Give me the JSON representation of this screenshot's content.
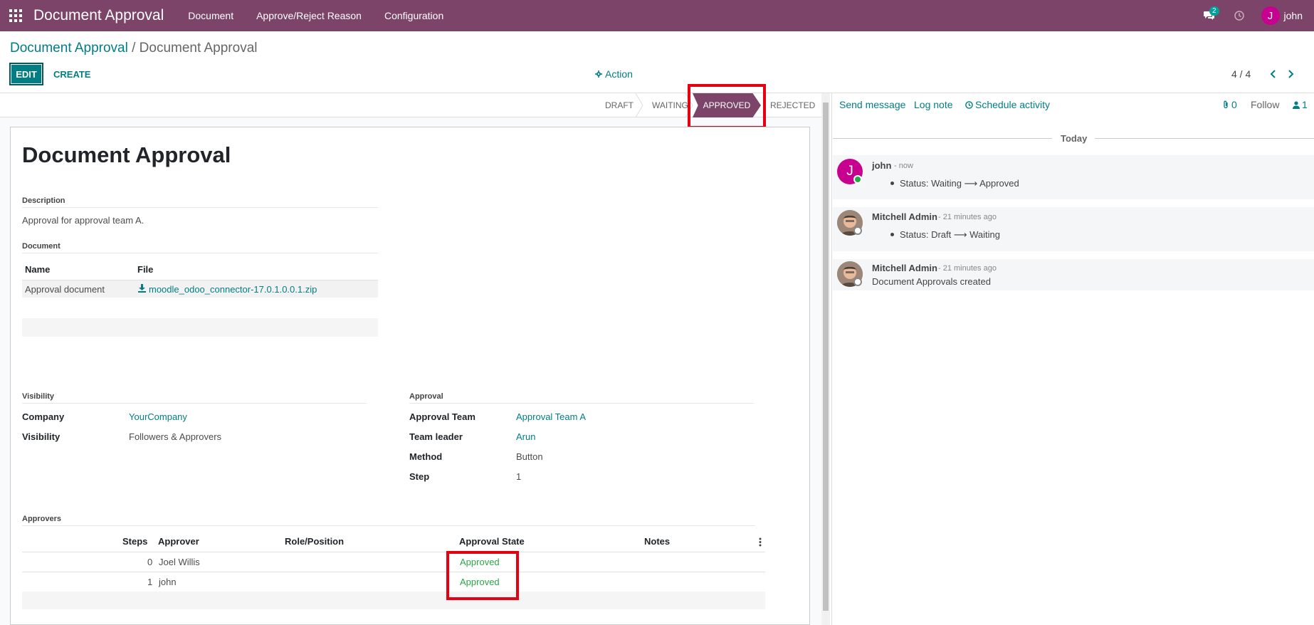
{
  "navbar": {
    "app_title": "Document Approval",
    "menu": [
      "Document",
      "Approve/Reject Reason",
      "Configuration"
    ],
    "messages_count": "2",
    "user_initial": "J",
    "user_name": "john"
  },
  "breadcrumb": {
    "parent": "Document Approval",
    "separator": "/",
    "current": "Document Approval"
  },
  "toolbar": {
    "edit_label": "EDIT",
    "create_label": "CREATE",
    "action_label": "Action",
    "pager": "4 / 4"
  },
  "statusbar": {
    "stages": [
      "DRAFT",
      "WAITING",
      "APPROVED",
      "REJECTED"
    ],
    "active": "APPROVED"
  },
  "form": {
    "title": "Document Approval",
    "description_label": "Description",
    "description": "Approval for approval team A.",
    "document_label": "Document",
    "doc_table": {
      "headers": [
        "Name",
        "File"
      ],
      "rows": [
        {
          "name": "Approval document",
          "file": "moodle_odoo_connector-17.0.1.0.0.1.zip"
        }
      ]
    },
    "visibility_section": "Visibility",
    "company_label": "Company",
    "company": "YourCompany",
    "visibility_label": "Visibility",
    "visibility": "Followers & Approvers",
    "approval_section": "Approval",
    "approval_team_label": "Approval Team",
    "approval_team": "Approval Team A",
    "team_leader_label": "Team leader",
    "team_leader": "Arun",
    "method_label": "Method",
    "method": "Button",
    "step_label": "Step",
    "step": "1",
    "approvers_section": "Approvers",
    "approvers_table": {
      "headers": [
        "Steps",
        "Approver",
        "Role/Position",
        "Approval State",
        "Notes"
      ],
      "rows": [
        {
          "step": "0",
          "approver": "Joel Willis",
          "role": "",
          "state": "Approved",
          "notes": ""
        },
        {
          "step": "1",
          "approver": "john",
          "role": "",
          "state": "Approved",
          "notes": ""
        }
      ]
    }
  },
  "chatter": {
    "send_message": "Send message",
    "log_note": "Log note",
    "schedule_activity": "Schedule activity",
    "attachments": "0",
    "follow": "Follow",
    "followers": "1",
    "date_separator": "Today",
    "messages": [
      {
        "author": "john",
        "time": "- now",
        "body": "Status: Waiting ⟶ Approved"
      },
      {
        "author": "Mitchell Admin",
        "time": "- 21 minutes ago",
        "body": "Status: Draft ⟶ Waiting"
      },
      {
        "author": "Mitchell Admin",
        "time": "- 21 minutes ago",
        "body": "Document Approvals created"
      }
    ]
  },
  "colors": {
    "brand": "#7c4468",
    "primary": "#017e84",
    "success": "#28a745",
    "highlight": "#e60012"
  }
}
